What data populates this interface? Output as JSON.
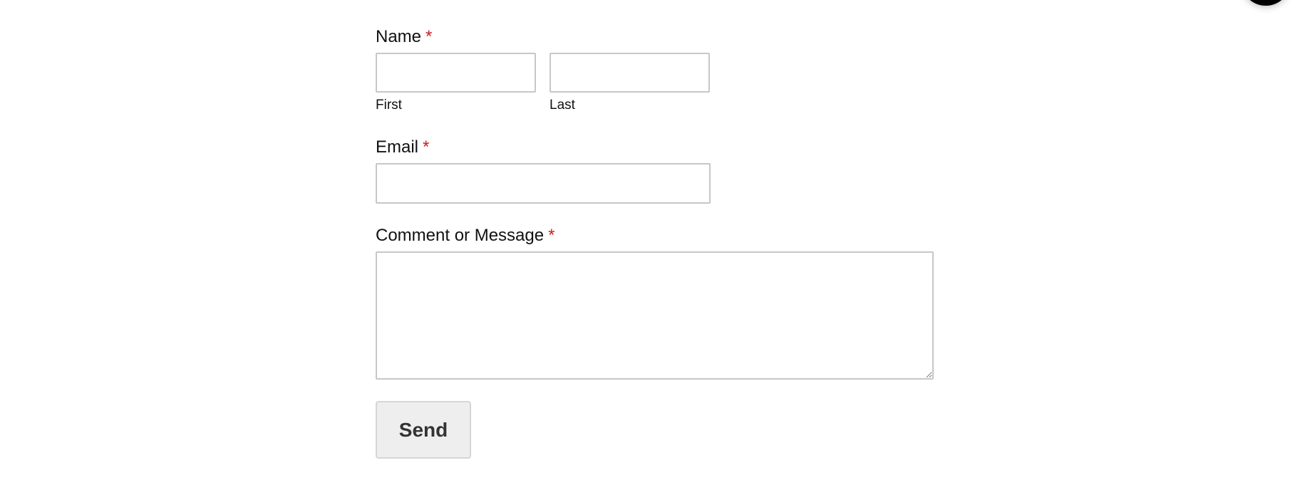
{
  "form": {
    "name": {
      "label": "Name",
      "required_marker": "*",
      "first": {
        "sublabel": "First",
        "value": ""
      },
      "last": {
        "sublabel": "Last",
        "value": ""
      }
    },
    "email": {
      "label": "Email",
      "required_marker": "*",
      "value": ""
    },
    "message": {
      "label": "Comment or Message",
      "required_marker": "*",
      "value": ""
    },
    "submit": {
      "label": "Send"
    }
  },
  "colors": {
    "required": "#d01b1b",
    "input_border": "#c7c7c7",
    "button_bg": "#eeeeee",
    "floating_button": "#000000"
  },
  "floating_button": {
    "icon": "chat-bubble-icon"
  }
}
